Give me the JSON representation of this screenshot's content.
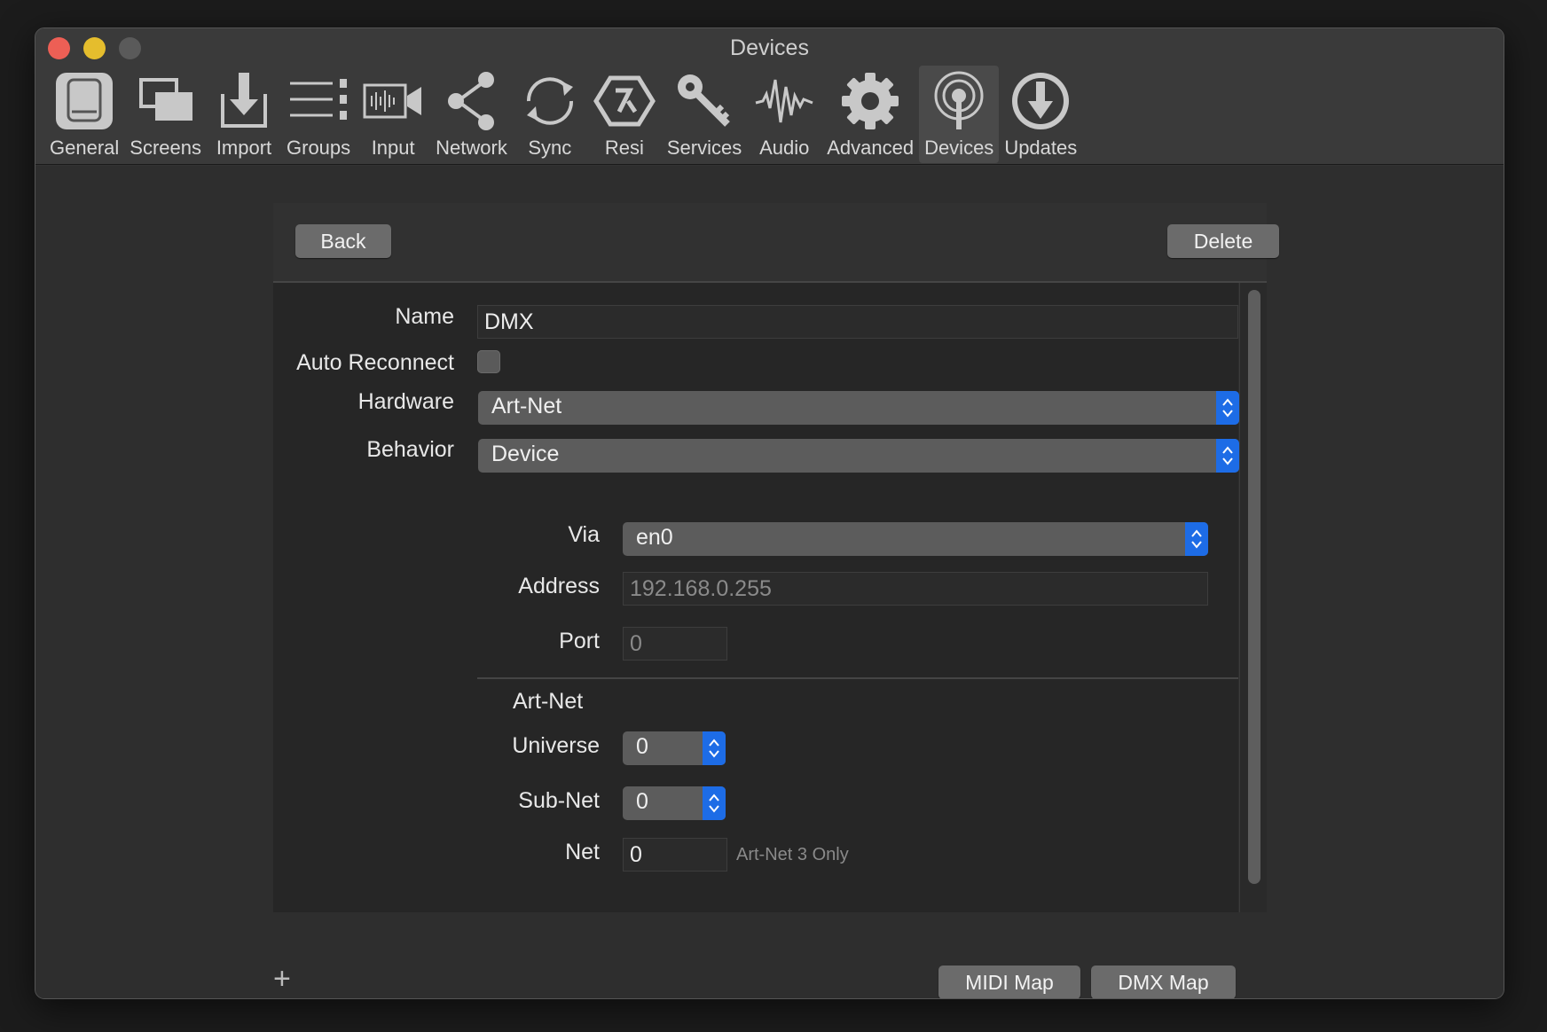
{
  "window": {
    "title": "Devices"
  },
  "toolbar": {
    "items": [
      {
        "label": "General",
        "icon": "general-icon"
      },
      {
        "label": "Screens",
        "icon": "screens-icon"
      },
      {
        "label": "Import",
        "icon": "import-icon"
      },
      {
        "label": "Groups",
        "icon": "groups-icon"
      },
      {
        "label": "Input",
        "icon": "input-icon"
      },
      {
        "label": "Network",
        "icon": "network-icon"
      },
      {
        "label": "Sync",
        "icon": "sync-icon"
      },
      {
        "label": "Resi",
        "icon": "resi-icon"
      },
      {
        "label": "Services",
        "icon": "services-key-icon"
      },
      {
        "label": "Audio",
        "icon": "audio-waveform-icon"
      },
      {
        "label": "Advanced",
        "icon": "gear-icon"
      },
      {
        "label": "Devices",
        "icon": "devices-broadcast-icon"
      },
      {
        "label": "Updates",
        "icon": "updates-download-icon"
      }
    ],
    "active": "Devices"
  },
  "panel": {
    "back_label": "Back",
    "delete_label": "Delete"
  },
  "form": {
    "name_label": "Name",
    "name_value": "DMX",
    "auto_reconnect_label": "Auto Reconnect",
    "auto_reconnect_checked": false,
    "hardware_label": "Hardware",
    "hardware_value": "Art-Net",
    "behavior_label": "Behavior",
    "behavior_value": "Device",
    "via_label": "Via",
    "via_value": "en0",
    "address_label": "Address",
    "address_value": "192.168.0.255",
    "port_label": "Port",
    "port_value": "0",
    "artnet_section": "Art-Net",
    "universe_label": "Universe",
    "universe_value": "0",
    "subnet_label": "Sub-Net",
    "subnet_value": "0",
    "net_label": "Net",
    "net_value": "0",
    "net_note": "Art-Net 3 Only"
  },
  "footer": {
    "add_symbol": "+",
    "midi_map_label": "MIDI Map",
    "dmx_map_label": "DMX Map"
  },
  "colors": {
    "accent": "#1d6ce6",
    "close": "#ed5f55",
    "minimize": "#e5bd2d"
  }
}
